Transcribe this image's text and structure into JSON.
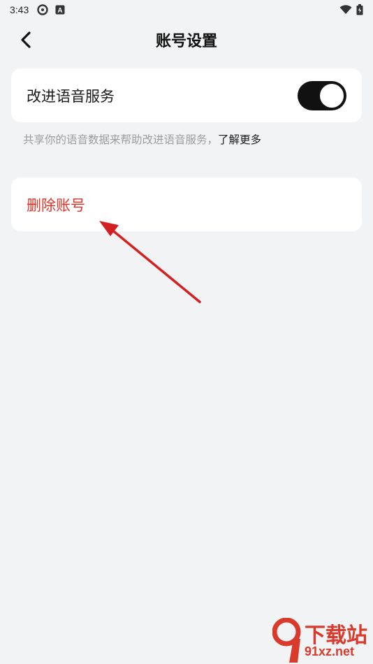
{
  "status_bar": {
    "time": "3:43"
  },
  "header": {
    "title": "账号设置",
    "back_icon": "chevron-left-icon"
  },
  "voice_card": {
    "label": "改进语音服务",
    "toggle_on": true
  },
  "hint": {
    "text": "共享你的语音数据来帮助改进语音服务，",
    "link": "了解更多"
  },
  "delete_card": {
    "label": "删除账号"
  },
  "watermark": {
    "top": "下载站",
    "bottom": "91xz.net"
  },
  "colors": {
    "background": "#f2f3f5",
    "danger": "#e53226",
    "toggle_on": "#111111",
    "annotation_arrow": "#d42020"
  }
}
